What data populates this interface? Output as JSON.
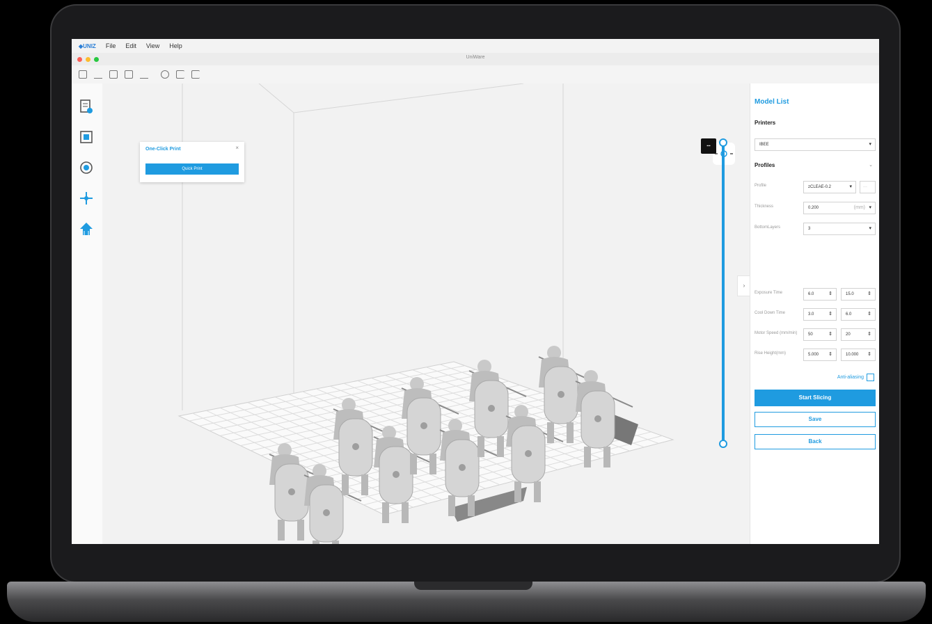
{
  "app": {
    "menu": [
      "File",
      "Edit",
      "View",
      "Help"
    ],
    "window_title": "UniWare"
  },
  "one_click": {
    "title": "One-Click Print",
    "close": "×",
    "button": "Quick Print"
  },
  "panel": {
    "title": "Model List",
    "printers_label": "Printers",
    "printer_value": "IBEE",
    "profiles_label": "Profiles",
    "rows": [
      {
        "label": "Profile",
        "value": "zCLEAE-0.2",
        "extra": "···"
      },
      {
        "label": "Thickness",
        "value": "0.200",
        "unit": "(mm)"
      },
      {
        "label": "BottomLayers",
        "value": "3"
      }
    ],
    "params": [
      {
        "label": "Exposure Time",
        "a": "6.0",
        "b": "15.0"
      },
      {
        "label": "Cool Down Time",
        "a": "3.0",
        "b": "6.0"
      },
      {
        "label": "Motor Speed (mm/min)",
        "a": "50",
        "b": "20"
      },
      {
        "label": "Rise Height(mm)",
        "a": "5.000",
        "b": "10.000"
      }
    ],
    "anti_aliasing": "Anti-aliasing",
    "start_slicing": "Start Slicing",
    "save": "Save",
    "back": "Back"
  },
  "colors": {
    "accent": "#1f9be0"
  }
}
